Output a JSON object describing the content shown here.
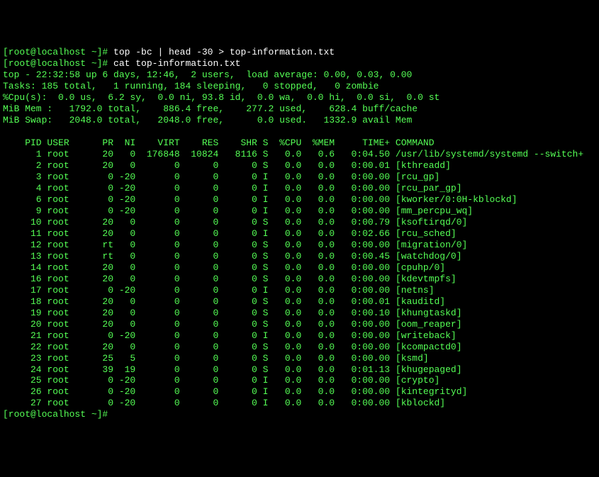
{
  "prompt1": "[root@localhost ~]#",
  "cmd1": "top -bc | head -30 > top-information.txt",
  "prompt2": "[root@localhost ~]#",
  "cmd2": "cat top-information.txt",
  "summary1": "top - 22:32:58 up 6 days, 12:46,  2 users,  load average: 0.00, 0.03, 0.00",
  "summary2": "Tasks: 185 total,   1 running, 184 sleeping,   0 stopped,   0 zombie",
  "summary3": "%Cpu(s):  0.0 us,  6.2 sy,  0.0 ni, 93.8 id,  0.0 wa,  0.0 hi,  0.0 si,  0.0 st",
  "summary4": "MiB Mem :   1792.0 total,    886.4 free,    277.2 used,    628.4 buff/cache",
  "summary5": "MiB Swap:   2048.0 total,   2048.0 free,      0.0 used.   1332.9 avail Mem",
  "header": "    PID USER      PR  NI    VIRT    RES    SHR S  %CPU  %MEM     TIME+ COMMAND",
  "rows": [
    {
      "pid": "1",
      "user": "root",
      "pr": "20",
      "ni": "0",
      "virt": "176848",
      "res": "10824",
      "shr": "8116",
      "s": "S",
      "cpu": "0.0",
      "mem": "0.6",
      "time": "0:04.50",
      "cmd": "/usr/lib/systemd/systemd --switch+"
    },
    {
      "pid": "2",
      "user": "root",
      "pr": "20",
      "ni": "0",
      "virt": "0",
      "res": "0",
      "shr": "0",
      "s": "S",
      "cpu": "0.0",
      "mem": "0.0",
      "time": "0:00.01",
      "cmd": "[kthreadd]"
    },
    {
      "pid": "3",
      "user": "root",
      "pr": "0",
      "ni": "-20",
      "virt": "0",
      "res": "0",
      "shr": "0",
      "s": "I",
      "cpu": "0.0",
      "mem": "0.0",
      "time": "0:00.00",
      "cmd": "[rcu_gp]"
    },
    {
      "pid": "4",
      "user": "root",
      "pr": "0",
      "ni": "-20",
      "virt": "0",
      "res": "0",
      "shr": "0",
      "s": "I",
      "cpu": "0.0",
      "mem": "0.0",
      "time": "0:00.00",
      "cmd": "[rcu_par_gp]"
    },
    {
      "pid": "6",
      "user": "root",
      "pr": "0",
      "ni": "-20",
      "virt": "0",
      "res": "0",
      "shr": "0",
      "s": "I",
      "cpu": "0.0",
      "mem": "0.0",
      "time": "0:00.00",
      "cmd": "[kworker/0:0H-kblockd]"
    },
    {
      "pid": "9",
      "user": "root",
      "pr": "0",
      "ni": "-20",
      "virt": "0",
      "res": "0",
      "shr": "0",
      "s": "I",
      "cpu": "0.0",
      "mem": "0.0",
      "time": "0:00.00",
      "cmd": "[mm_percpu_wq]"
    },
    {
      "pid": "10",
      "user": "root",
      "pr": "20",
      "ni": "0",
      "virt": "0",
      "res": "0",
      "shr": "0",
      "s": "S",
      "cpu": "0.0",
      "mem": "0.0",
      "time": "0:00.79",
      "cmd": "[ksoftirqd/0]"
    },
    {
      "pid": "11",
      "user": "root",
      "pr": "20",
      "ni": "0",
      "virt": "0",
      "res": "0",
      "shr": "0",
      "s": "I",
      "cpu": "0.0",
      "mem": "0.0",
      "time": "0:02.66",
      "cmd": "[rcu_sched]"
    },
    {
      "pid": "12",
      "user": "root",
      "pr": "rt",
      "ni": "0",
      "virt": "0",
      "res": "0",
      "shr": "0",
      "s": "S",
      "cpu": "0.0",
      "mem": "0.0",
      "time": "0:00.00",
      "cmd": "[migration/0]"
    },
    {
      "pid": "13",
      "user": "root",
      "pr": "rt",
      "ni": "0",
      "virt": "0",
      "res": "0",
      "shr": "0",
      "s": "S",
      "cpu": "0.0",
      "mem": "0.0",
      "time": "0:00.45",
      "cmd": "[watchdog/0]"
    },
    {
      "pid": "14",
      "user": "root",
      "pr": "20",
      "ni": "0",
      "virt": "0",
      "res": "0",
      "shr": "0",
      "s": "S",
      "cpu": "0.0",
      "mem": "0.0",
      "time": "0:00.00",
      "cmd": "[cpuhp/0]"
    },
    {
      "pid": "16",
      "user": "root",
      "pr": "20",
      "ni": "0",
      "virt": "0",
      "res": "0",
      "shr": "0",
      "s": "S",
      "cpu": "0.0",
      "mem": "0.0",
      "time": "0:00.00",
      "cmd": "[kdevtmpfs]"
    },
    {
      "pid": "17",
      "user": "root",
      "pr": "0",
      "ni": "-20",
      "virt": "0",
      "res": "0",
      "shr": "0",
      "s": "I",
      "cpu": "0.0",
      "mem": "0.0",
      "time": "0:00.00",
      "cmd": "[netns]"
    },
    {
      "pid": "18",
      "user": "root",
      "pr": "20",
      "ni": "0",
      "virt": "0",
      "res": "0",
      "shr": "0",
      "s": "S",
      "cpu": "0.0",
      "mem": "0.0",
      "time": "0:00.01",
      "cmd": "[kauditd]"
    },
    {
      "pid": "19",
      "user": "root",
      "pr": "20",
      "ni": "0",
      "virt": "0",
      "res": "0",
      "shr": "0",
      "s": "S",
      "cpu": "0.0",
      "mem": "0.0",
      "time": "0:00.10",
      "cmd": "[khungtaskd]"
    },
    {
      "pid": "20",
      "user": "root",
      "pr": "20",
      "ni": "0",
      "virt": "0",
      "res": "0",
      "shr": "0",
      "s": "S",
      "cpu": "0.0",
      "mem": "0.0",
      "time": "0:00.00",
      "cmd": "[oom_reaper]"
    },
    {
      "pid": "21",
      "user": "root",
      "pr": "0",
      "ni": "-20",
      "virt": "0",
      "res": "0",
      "shr": "0",
      "s": "I",
      "cpu": "0.0",
      "mem": "0.0",
      "time": "0:00.00",
      "cmd": "[writeback]"
    },
    {
      "pid": "22",
      "user": "root",
      "pr": "20",
      "ni": "0",
      "virt": "0",
      "res": "0",
      "shr": "0",
      "s": "S",
      "cpu": "0.0",
      "mem": "0.0",
      "time": "0:00.00",
      "cmd": "[kcompactd0]"
    },
    {
      "pid": "23",
      "user": "root",
      "pr": "25",
      "ni": "5",
      "virt": "0",
      "res": "0",
      "shr": "0",
      "s": "S",
      "cpu": "0.0",
      "mem": "0.0",
      "time": "0:00.00",
      "cmd": "[ksmd]"
    },
    {
      "pid": "24",
      "user": "root",
      "pr": "39",
      "ni": "19",
      "virt": "0",
      "res": "0",
      "shr": "0",
      "s": "S",
      "cpu": "0.0",
      "mem": "0.0",
      "time": "0:01.13",
      "cmd": "[khugepaged]"
    },
    {
      "pid": "25",
      "user": "root",
      "pr": "0",
      "ni": "-20",
      "virt": "0",
      "res": "0",
      "shr": "0",
      "s": "I",
      "cpu": "0.0",
      "mem": "0.0",
      "time": "0:00.00",
      "cmd": "[crypto]"
    },
    {
      "pid": "26",
      "user": "root",
      "pr": "0",
      "ni": "-20",
      "virt": "0",
      "res": "0",
      "shr": "0",
      "s": "I",
      "cpu": "0.0",
      "mem": "0.0",
      "time": "0:00.00",
      "cmd": "[kintegrityd]"
    },
    {
      "pid": "27",
      "user": "root",
      "pr": "0",
      "ni": "-20",
      "virt": "0",
      "res": "0",
      "shr": "0",
      "s": "I",
      "cpu": "0.0",
      "mem": "0.0",
      "time": "0:00.00",
      "cmd": "[kblockd]"
    }
  ],
  "prompt3": "[root@localhost ~]#"
}
